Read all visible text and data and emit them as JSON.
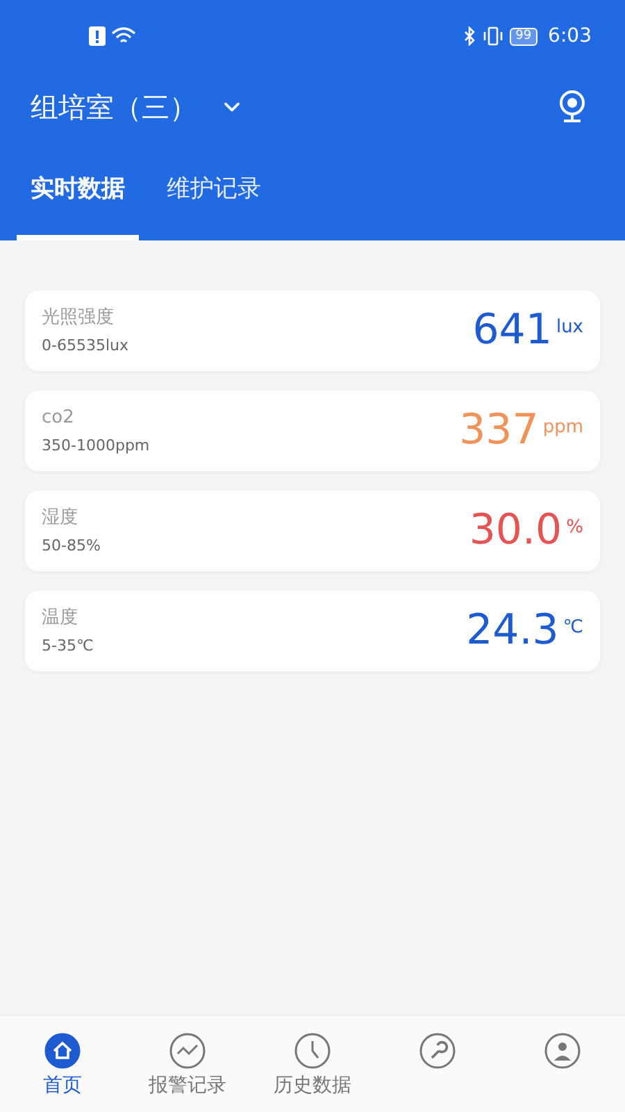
{
  "status_bar": {
    "time": "6:03",
    "battery": "99"
  },
  "header": {
    "title": "组培室（三）"
  },
  "tabs": [
    {
      "label": "实时数据",
      "selected": true
    },
    {
      "label": "维护记录",
      "selected": false
    }
  ],
  "readings": [
    {
      "name": "光照强度",
      "range": "0-65535lux",
      "value": "641",
      "unit": "lux",
      "color": "#1f5bd0"
    },
    {
      "name": "co2",
      "range": "350-1000ppm",
      "value": "337",
      "unit": "ppm",
      "color": "#f0935a"
    },
    {
      "name": "湿度",
      "range": "50-85%",
      "value": "30.0",
      "unit": "%",
      "color": "#e55454"
    },
    {
      "name": "温度",
      "range": "5-35℃",
      "value": "24.3",
      "unit": "℃",
      "color": "#1f5bd0"
    }
  ],
  "nav": [
    {
      "kind": "home",
      "label": "首页",
      "selected": true
    },
    {
      "kind": "alarm",
      "label": "报警记录",
      "selected": false
    },
    {
      "kind": "history",
      "label": "历史数据",
      "selected": false
    },
    {
      "kind": "maintenance",
      "selected": false
    },
    {
      "kind": "profile",
      "selected": false
    }
  ]
}
